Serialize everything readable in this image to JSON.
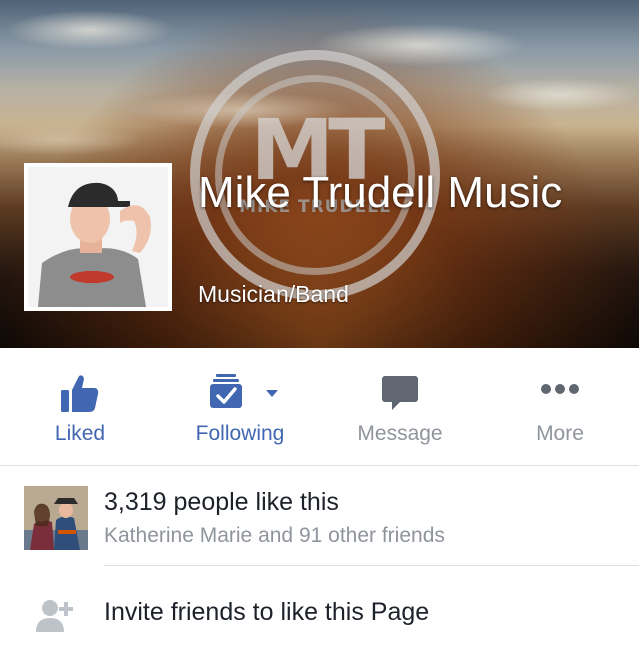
{
  "page": {
    "name": "Mike Trudell Music",
    "category": "Musician/Band",
    "logo_text": "MT",
    "logo_subtext": "MIKE TRUDELL"
  },
  "actions": [
    {
      "label": "Liked",
      "icon": "thumbs-up-icon",
      "color": "#4267b2"
    },
    {
      "label": "Following",
      "icon": "following-feed-icon",
      "color": "#4267b2"
    },
    {
      "label": "Message",
      "icon": "message-bubble-icon",
      "color": "#90949c"
    },
    {
      "label": "More",
      "icon": "more-dots-icon",
      "color": "#90949c"
    }
  ],
  "likes": {
    "count_text": "3,319 people like this",
    "friends_text": "Katherine Marie and 91 other friends"
  },
  "invite": {
    "label": "Invite friends to like this Page",
    "icon": "add-friend-icon"
  },
  "colors": {
    "accent": "#4267b2",
    "muted": "#90949c",
    "text": "#1d2129",
    "divider": "#dddfe2"
  }
}
